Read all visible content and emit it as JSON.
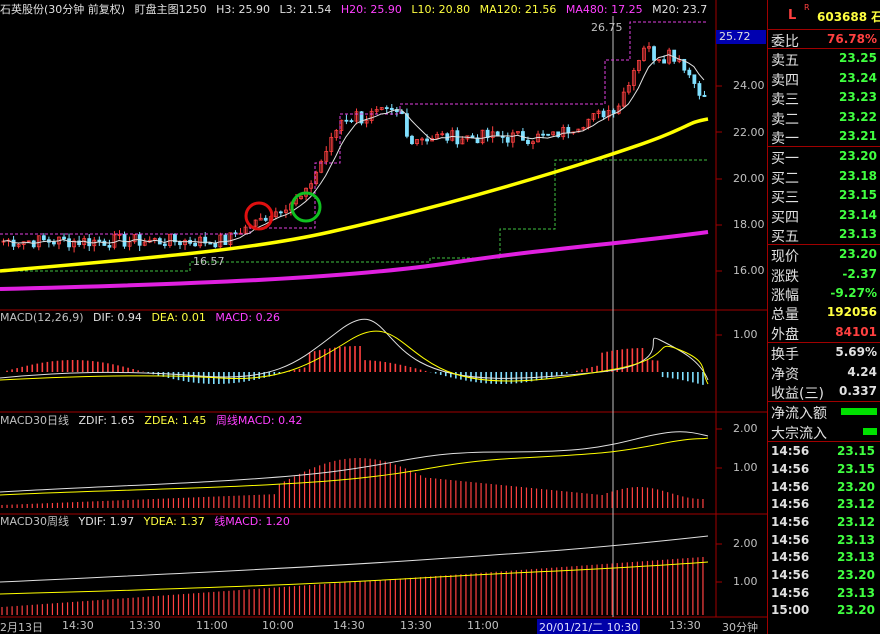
{
  "main_header": {
    "stock_name": "石英股份",
    "period": "(30分钟 前复权)",
    "indicator": "盯盘主图1250",
    "h3": "H3: 25.90",
    "l3": "L3: 21.54",
    "h20": "H20: 25.90",
    "l10": "L10: 20.80",
    "ma120": "MA120: 21.56",
    "ma480": "MA480: 17.25",
    "m20": "M20: 23.7"
  },
  "main_price_labels": {
    "high_marker": "26.75",
    "low_marker": "16.57",
    "current_box": "25.72",
    "ticks": [
      "24.00",
      "22.00",
      "20.00",
      "18.00",
      "16.00"
    ]
  },
  "macd_header": {
    "name": "MACD(12,26,9)",
    "dif": "DIF: 0.94",
    "dea": "DEA: 0.01",
    "macd": "MACD: 0.26"
  },
  "macd_ticks": [
    "1.00"
  ],
  "macd30d_header": {
    "name": "MACD30日线",
    "zdif": "ZDIF: 1.65",
    "zdea": "ZDEA: 1.45",
    "zmacd": "周线MACD: 0.42"
  },
  "macd30d_ticks": [
    "2.00",
    "1.00"
  ],
  "macd30w_header": {
    "name": "MACD30周线",
    "ydif": "YDIF: 1.97",
    "ydea": "YDEA: 1.37",
    "ymacd": "线MACD: 1.20"
  },
  "macd30w_ticks": [
    "2.00",
    "1.00"
  ],
  "x_axis": {
    "labels": [
      "2月13日",
      "14:30",
      "13:30",
      "11:00",
      "10:00",
      "14:30",
      "13:30",
      "11:00",
      "10:30",
      "13:30"
    ],
    "highlight": "20/01/21/二 10:30",
    "period_label": "30分钟"
  },
  "side": {
    "flag_l": "L",
    "flag_r": "R",
    "code": "603688 石",
    "wei_bi_label": "委比",
    "wei_bi_value": "76.78%",
    "asks": [
      {
        "label": "卖五",
        "price": "23.25"
      },
      {
        "label": "卖四",
        "price": "23.24"
      },
      {
        "label": "卖三",
        "price": "23.23"
      },
      {
        "label": "卖二",
        "price": "23.22"
      },
      {
        "label": "卖一",
        "price": "23.21"
      }
    ],
    "bids": [
      {
        "label": "买一",
        "price": "23.20"
      },
      {
        "label": "买二",
        "price": "23.18"
      },
      {
        "label": "买三",
        "price": "23.15"
      },
      {
        "label": "买四",
        "price": "23.14"
      },
      {
        "label": "买五",
        "price": "23.13"
      }
    ],
    "quote": [
      {
        "label": "现价",
        "value": "23.20",
        "color": "g"
      },
      {
        "label": "涨跌",
        "value": "-2.37",
        "color": "g"
      },
      {
        "label": "涨幅",
        "value": "-9.27%",
        "color": "g"
      },
      {
        "label": "总量",
        "value": "192056",
        "color": "y"
      },
      {
        "label": "外盘",
        "value": "84101",
        "color": "r"
      }
    ],
    "stats": [
      {
        "label": "换手",
        "value": "5.69%"
      },
      {
        "label": "净资",
        "value": "4.24"
      },
      {
        "label": "收益(三)",
        "value": "0.337"
      }
    ],
    "flows": [
      {
        "label": "净流入额",
        "bar": 0.9
      },
      {
        "label": "大宗流入",
        "bar": 0.35
      }
    ],
    "ticks": [
      {
        "time": "14:56",
        "price": "23.15"
      },
      {
        "time": "14:56",
        "price": "23.15"
      },
      {
        "time": "14:56",
        "price": "23.20"
      },
      {
        "time": "14:56",
        "price": "23.12"
      },
      {
        "time": "14:56",
        "price": "23.12"
      },
      {
        "time": "14:56",
        "price": "23.13"
      },
      {
        "time": "14:56",
        "price": "23.13"
      },
      {
        "time": "14:56",
        "price": "23.20"
      },
      {
        "time": "14:56",
        "price": "23.13"
      },
      {
        "time": "15:00",
        "price": "23.20"
      }
    ]
  },
  "colors": {
    "up": "#ff4040",
    "down": "#40ff40",
    "ma_yellow": "#ffff00",
    "ma_magenta": "#e020e0",
    "divider": "#a00000",
    "macd_cyan": "#80e0ff"
  }
}
